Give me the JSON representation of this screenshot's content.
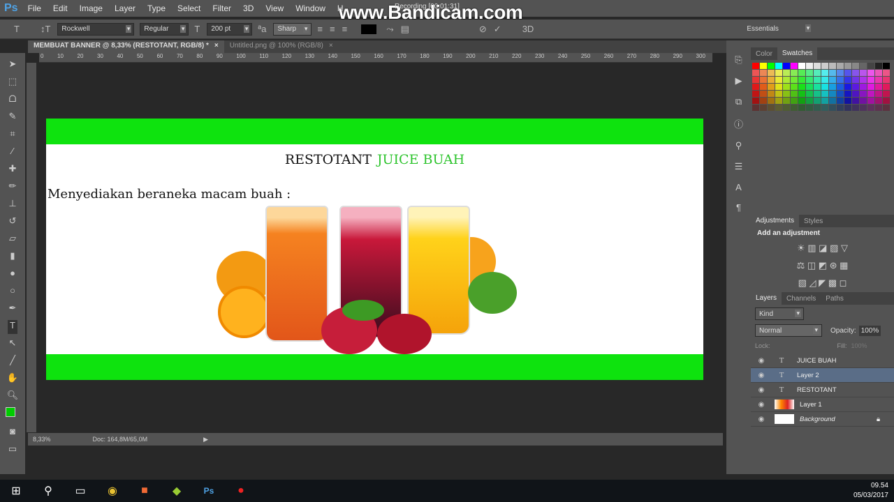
{
  "app": {
    "logo": "Ps",
    "menu": [
      "File",
      "Edit",
      "Image",
      "Layer",
      "Type",
      "Select",
      "Filter",
      "3D",
      "View",
      "Window",
      "H"
    ]
  },
  "overlay": {
    "watermark": "www.Bandicam.com",
    "recording": "Recording [00:01:31]"
  },
  "options": {
    "font_family": "Rockwell",
    "font_style": "Regular",
    "font_size": "200 pt",
    "antialias": "Sharp",
    "workspace": "Essentials",
    "text_color": "#000000"
  },
  "tabs": [
    {
      "label": "MEMBUAT BANNER @ 8,33% (RESTOTANT, RGB/8) *",
      "close": "×"
    },
    {
      "label": "Untitled.png @ 100% (RGB/8)",
      "close": "×"
    }
  ],
  "ruler": [
    "0",
    "10",
    "20",
    "30",
    "40",
    "50",
    "60",
    "70",
    "80",
    "90",
    "100",
    "110",
    "120",
    "130",
    "140",
    "150",
    "160",
    "170",
    "180",
    "190",
    "200",
    "210",
    "220",
    "230",
    "240",
    "250",
    "260",
    "270",
    "280",
    "290",
    "300"
  ],
  "banner": {
    "title_a": "RESTOTANT",
    "title_b": "JUICE BUAH",
    "tagline": "Menyediakan beraneka macam buah :",
    "green": "#0ee30e"
  },
  "status": {
    "zoom": "8,33%",
    "doc": "Doc: 164,8M/65,0M"
  },
  "panels": {
    "color_tab": "Color",
    "swatches_tab": "Swatches",
    "adjustments_tab": "Adjustments",
    "styles_tab": "Styles",
    "add_adjustment": "Add an adjustment",
    "layers_tab": "Layers",
    "channels_tab": "Channels",
    "paths_tab": "Paths",
    "kind": "Kind",
    "blend": "Normal",
    "opacity_label": "Opacity:",
    "opacity": "100%",
    "lock_label": "Lock:",
    "fill_label": "Fill:",
    "fill": "100%",
    "layers": [
      {
        "name": "JUICE BUAH",
        "type": "text"
      },
      {
        "name": "Layer 2",
        "type": "text",
        "selected": true
      },
      {
        "name": "RESTOTANT",
        "type": "text"
      },
      {
        "name": "Layer 1",
        "type": "image"
      },
      {
        "name": "Background",
        "type": "background",
        "locked": true
      }
    ]
  },
  "taskbar": {
    "time": "09.54",
    "date": "05/03/2017"
  }
}
